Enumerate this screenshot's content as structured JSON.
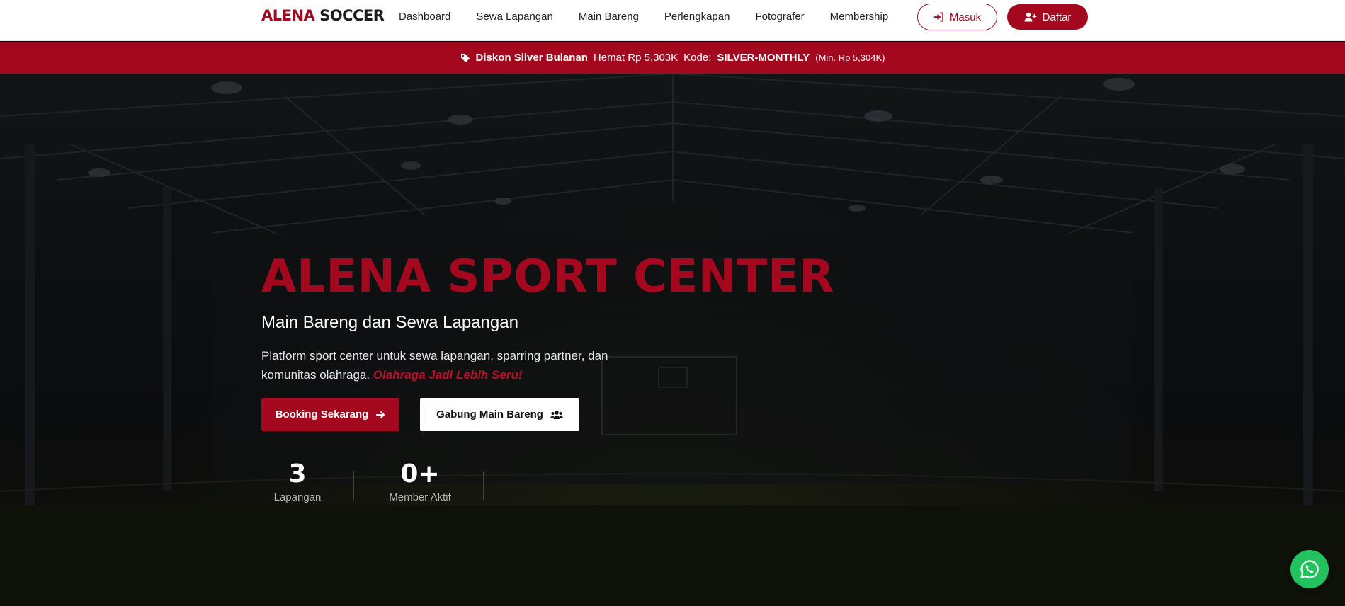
{
  "brand": {
    "part1": "ALENA",
    "part2": "SOCCER"
  },
  "nav": {
    "links": [
      "Dashboard",
      "Sewa Lapangan",
      "Main Bareng",
      "Perlengkapan",
      "Fotografer",
      "Membership"
    ],
    "login_label": "Masuk",
    "register_label": "Daftar"
  },
  "promo": {
    "name": "Diskon Silver Bulanan",
    "saving": "Hemat Rp 5,303K",
    "code_label": "Kode:",
    "code": "SILVER-MONTHLY",
    "min": "(Min. Rp 5,304K)"
  },
  "hero": {
    "title": "ALENA SPORT CENTER",
    "subtitle": "Main Bareng dan Sewa Lapangan",
    "description": "Platform sport center untuk sewa lapangan, sparring partner, dan komunitas olahraga.",
    "description_accent": "Olahraga Jadi Lebih Seru!",
    "booking_label": "Booking Sekarang",
    "join_label": "Gabung Main Bareng"
  },
  "stats": [
    {
      "value": "3",
      "label": "Lapangan"
    },
    {
      "value": "0+",
      "label": "Member Aktif"
    }
  ],
  "colors": {
    "brand": "#a4081f",
    "whatsapp": "#22c35e",
    "navbar_bg": "#ffffff"
  },
  "icons": {
    "promo": "tag-icon",
    "login": "sign-in-icon",
    "register": "user-plus-icon",
    "booking": "arrow-right-icon",
    "join": "users-icon",
    "fab": "whatsapp-icon"
  }
}
